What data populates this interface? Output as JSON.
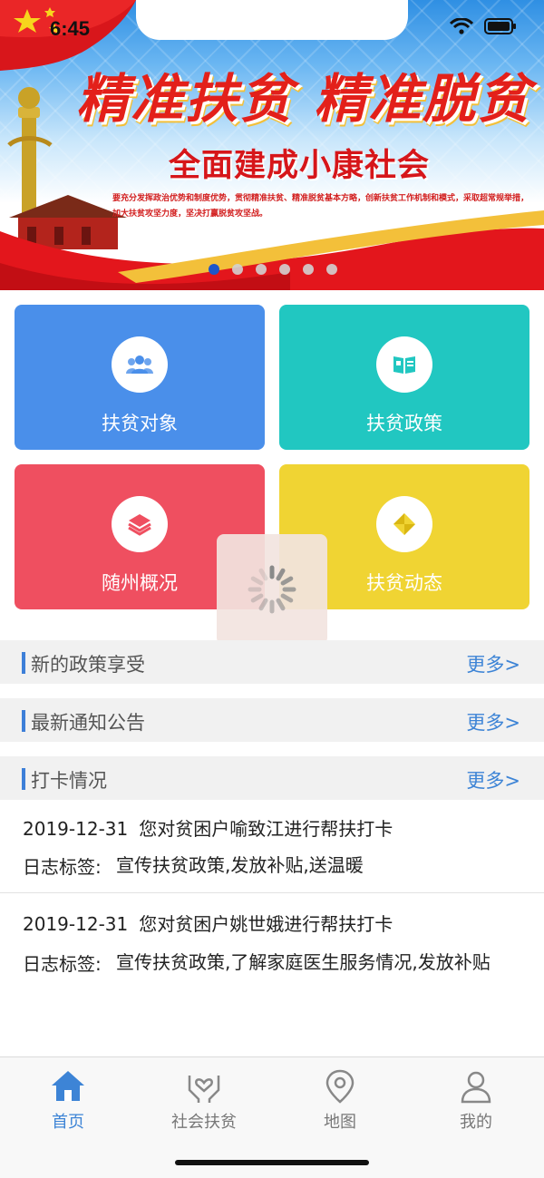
{
  "status_bar": {
    "time": "6:45"
  },
  "banner": {
    "headline": "精准扶贫 精准脱贫",
    "subhead": "全面建成小康社会",
    "tagline": "要充分发挥政治优势和制度优势，贯彻精准扶贫、精准脱贫基本方略，创新扶贫工作机制和模式，采取超常规举措，加大扶贫攻坚力度，坚决打赢脱贫攻坚战。",
    "carousel_dots": 6,
    "active_dot": 0
  },
  "tiles": [
    {
      "label": "扶贫对象",
      "icon": "people-icon",
      "color": "#4a8fea"
    },
    {
      "label": "扶贫政策",
      "icon": "book-icon",
      "color": "#21c7c1"
    },
    {
      "label": "随州概况",
      "icon": "layers-icon",
      "color": "#ef4f60"
    },
    {
      "label": "扶贫动态",
      "icon": "diamond-icon",
      "color": "#f0d433"
    }
  ],
  "sections": [
    {
      "title": "新的政策享受",
      "more": "更多>"
    },
    {
      "title": "最新通知公告",
      "more": "更多>"
    },
    {
      "title": "打卡情况",
      "more": "更多>"
    }
  ],
  "checkins": [
    {
      "date": "2019-12-31",
      "text": "您对贫困户喻致江进行帮扶打卡",
      "tag_label": "日志标签:",
      "tags": "宣传扶贫政策,发放补贴,送温暖"
    },
    {
      "date": "2019-12-31",
      "text": "您对贫困户姚世娥进行帮扶打卡",
      "tag_label": "日志标签:",
      "tags": "宣传扶贫政策,了解家庭医生服务情况,发放补贴"
    }
  ],
  "tabbar": [
    {
      "label": "首页",
      "icon": "home-icon",
      "active": true
    },
    {
      "label": "社会扶贫",
      "icon": "hands-heart-icon",
      "active": false
    },
    {
      "label": "地图",
      "icon": "map-pin-icon",
      "active": false
    },
    {
      "label": "我的",
      "icon": "user-icon",
      "active": false
    }
  ],
  "colors": {
    "accent": "#3d84d6",
    "banner_red": "#e3201a"
  }
}
